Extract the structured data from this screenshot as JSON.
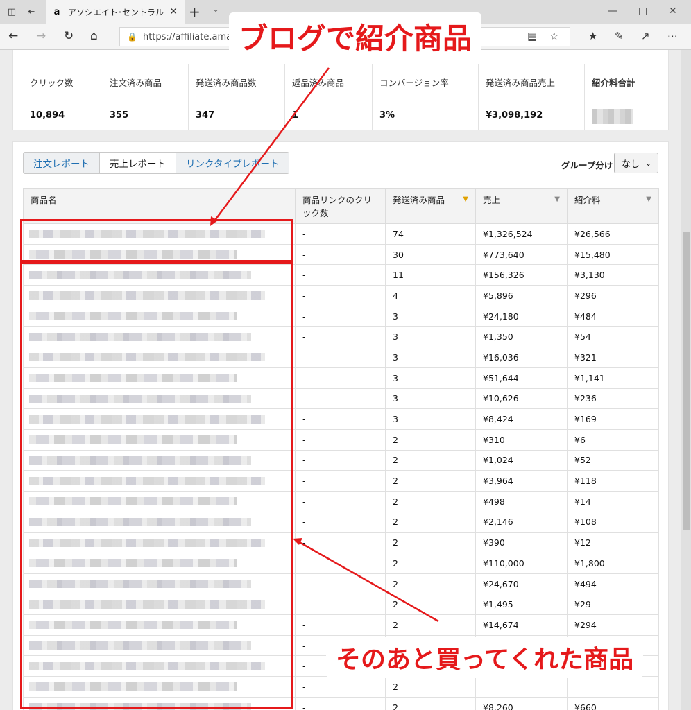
{
  "browser": {
    "tab_title": "アソシエイト･セントラル - レ",
    "favicon": "a",
    "url": "https://affiliate.amaz",
    "icons": [
      "tab-list-icon",
      "back-to-tabs-icon",
      "close-icon",
      "new-tab-icon",
      "chevron-down-icon",
      "minimize-icon",
      "maximize-icon",
      "window-close-icon",
      "back-icon",
      "forward-icon",
      "refresh-icon",
      "home-icon",
      "lock-icon",
      "reading-view-icon",
      "favorite-star-icon",
      "favorites-hub-icon",
      "pen-icon",
      "share-icon",
      "more-icon"
    ]
  },
  "summary": {
    "metrics": [
      {
        "label": "クリック数",
        "value": "10,894"
      },
      {
        "label": "注文済み商品",
        "value": "355"
      },
      {
        "label": "発送済み商品数",
        "value": "347"
      },
      {
        "label": "返品済み商品",
        "value": "1"
      },
      {
        "label": "コンバージョン率",
        "value": "3%"
      },
      {
        "label": "発送済み商品売上",
        "value": "¥3,098,192"
      },
      {
        "label": "紹介料合計",
        "value": ""
      }
    ]
  },
  "report": {
    "tabs": [
      {
        "label": "注文レポート",
        "active": false
      },
      {
        "label": "売上レポート",
        "active": true
      },
      {
        "label": "リンクタイプレポート",
        "active": false
      }
    ],
    "group_label": "グループ分け",
    "group_value": "なし",
    "columns": [
      "商品名",
      "商品リンクのクリック数",
      "発送済み商品",
      "売上",
      "紹介料"
    ],
    "rows": [
      {
        "clicks": "-",
        "shipped": "74",
        "sales": "¥1,326,524",
        "fee": "¥26,566"
      },
      {
        "clicks": "-",
        "shipped": "30",
        "sales": "¥773,640",
        "fee": "¥15,480"
      },
      {
        "clicks": "-",
        "shipped": "11",
        "sales": "¥156,326",
        "fee": "¥3,130"
      },
      {
        "clicks": "-",
        "shipped": "4",
        "sales": "¥5,896",
        "fee": "¥296"
      },
      {
        "clicks": "-",
        "shipped": "3",
        "sales": "¥24,180",
        "fee": "¥484"
      },
      {
        "clicks": "-",
        "shipped": "3",
        "sales": "¥1,350",
        "fee": "¥54"
      },
      {
        "clicks": "-",
        "shipped": "3",
        "sales": "¥16,036",
        "fee": "¥321"
      },
      {
        "clicks": "-",
        "shipped": "3",
        "sales": "¥51,644",
        "fee": "¥1,141"
      },
      {
        "clicks": "-",
        "shipped": "3",
        "sales": "¥10,626",
        "fee": "¥236"
      },
      {
        "clicks": "-",
        "shipped": "3",
        "sales": "¥8,424",
        "fee": "¥169"
      },
      {
        "clicks": "-",
        "shipped": "2",
        "sales": "¥310",
        "fee": "¥6"
      },
      {
        "clicks": "-",
        "shipped": "2",
        "sales": "¥1,024",
        "fee": "¥52"
      },
      {
        "clicks": "-",
        "shipped": "2",
        "sales": "¥3,964",
        "fee": "¥118"
      },
      {
        "clicks": "-",
        "shipped": "2",
        "sales": "¥498",
        "fee": "¥14"
      },
      {
        "clicks": "-",
        "shipped": "2",
        "sales": "¥2,146",
        "fee": "¥108"
      },
      {
        "clicks": "-",
        "shipped": "2",
        "sales": "¥390",
        "fee": "¥12"
      },
      {
        "clicks": "-",
        "shipped": "2",
        "sales": "¥110,000",
        "fee": "¥1,800"
      },
      {
        "clicks": "-",
        "shipped": "2",
        "sales": "¥24,670",
        "fee": "¥494"
      },
      {
        "clicks": "-",
        "shipped": "2",
        "sales": "¥1,495",
        "fee": "¥29"
      },
      {
        "clicks": "-",
        "shipped": "2",
        "sales": "¥14,674",
        "fee": "¥294"
      },
      {
        "clicks": "-",
        "shipped": "2",
        "sales": "",
        "fee": ""
      },
      {
        "clicks": "-",
        "shipped": "2",
        "sales": "",
        "fee": ""
      },
      {
        "clicks": "-",
        "shipped": "2",
        "sales": "",
        "fee": ""
      },
      {
        "clicks": "-",
        "shipped": "2",
        "sales": "¥8,260",
        "fee": "¥660"
      }
    ]
  },
  "annotations": {
    "top_callout": "ブログで紹介商品",
    "bottom_callout": "そのあと買ってくれた商品",
    "color": "#e5191b"
  }
}
